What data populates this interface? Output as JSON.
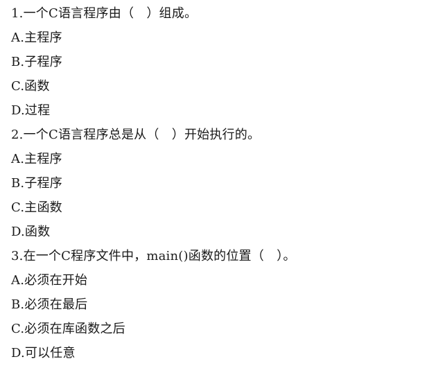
{
  "questions": [
    {
      "stem": "1.一个C语言程序由（　）组成。",
      "options": [
        "A.主程序",
        "B.子程序",
        "C.函数",
        "D.过程"
      ]
    },
    {
      "stem": "2.一个C语言程序总是从（　）开始执行的。",
      "options": [
        "A.主程序",
        "B.子程序",
        "C.主函数",
        "D.函数"
      ]
    },
    {
      "stem": "3.在一个C程序文件中，main()函数的位置（　）。",
      "options": [
        "A.必须在开始",
        "B.必须在最后",
        "C.必须在库函数之后",
        "D.可以任意"
      ]
    }
  ]
}
